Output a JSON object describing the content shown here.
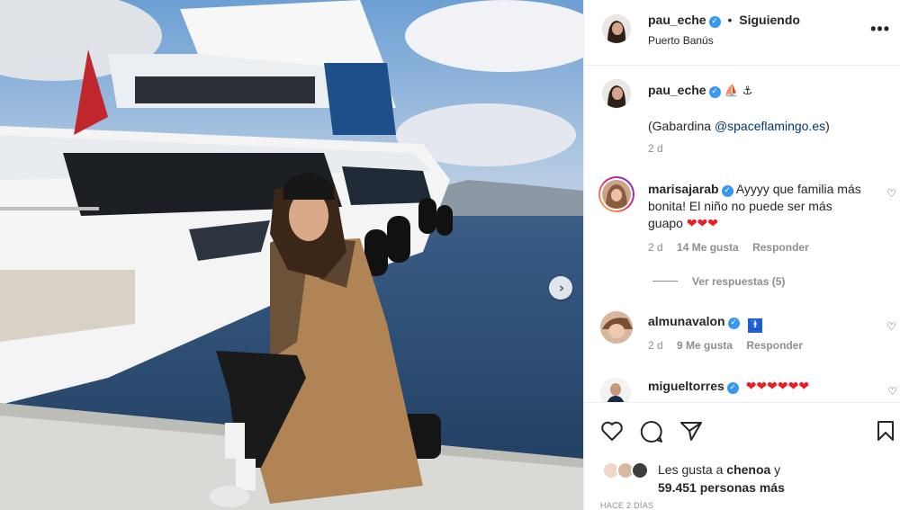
{
  "post": {
    "author": "pau_eche",
    "follow_status": "Siguiendo",
    "separator": "•",
    "location": "Puerto Banús",
    "more_icon": "more-horizontal-icon"
  },
  "caption": {
    "author": "pau_eche",
    "emojis": "⛵ ⚓",
    "text_prefix": "(Gabardina ",
    "mention": "@spaceflamingo.es",
    "text_suffix": ")",
    "time": "2 d"
  },
  "comments": [
    {
      "user": "marisajarab",
      "text": "Ayyyy que familia más bonita! El niño no puede ser más guapo",
      "hearts": "❤❤❤",
      "time": "2 d",
      "likes": "14 Me gusta",
      "reply": "Responder",
      "view_replies": "Ver respuestas (5)"
    },
    {
      "user": "almunavalon",
      "badge": "🚹",
      "time": "2 d",
      "likes": "9 Me gusta",
      "reply": "Responder"
    },
    {
      "user": "migueltorres",
      "hearts": "❤❤❤❤❤❤"
    }
  ],
  "likes": {
    "prefix": "Les gusta a ",
    "user": "chenoa",
    "middle": " y",
    "count": "59.451 personas más"
  },
  "time_ago": "HACE 2 DÍAS",
  "colors": {
    "verified": "#3897f0",
    "mention": "#00376b",
    "heart": "#ed1c24",
    "muted": "#8e8e8e"
  }
}
